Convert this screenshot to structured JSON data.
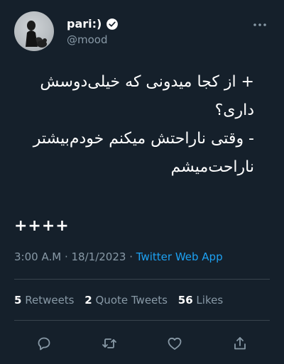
{
  "user": {
    "display_name": "pari:)",
    "handle": "@mood"
  },
  "icons": {
    "verified": "verified-badge-icon",
    "more": "more-options-icon",
    "reply": "reply-icon",
    "retweet": "retweet-icon",
    "like": "like-icon",
    "share": "share-icon"
  },
  "tweet": {
    "lines": [
      "+ از کجا میدونی که خیلی‌دوسش",
      "داری؟",
      "- وقتی ناراحتش میکنم خودم‌بیشتر",
      "ناراحت‌میشم"
    ],
    "footer": "++++"
  },
  "meta": {
    "time": "3:00 A.M",
    "separator": "·",
    "date": "18/1/2023",
    "source": "Twitter Web App"
  },
  "stats": {
    "retweets": {
      "count": "5",
      "label": "Retweets"
    },
    "quotes": {
      "count": "2",
      "label": "Quote Tweets"
    },
    "likes": {
      "count": "56",
      "label": "Likes"
    }
  },
  "colors": {
    "background": "#15202b",
    "secondary": "#8899a6",
    "accent": "#1da1f2",
    "divider": "#38444d"
  }
}
